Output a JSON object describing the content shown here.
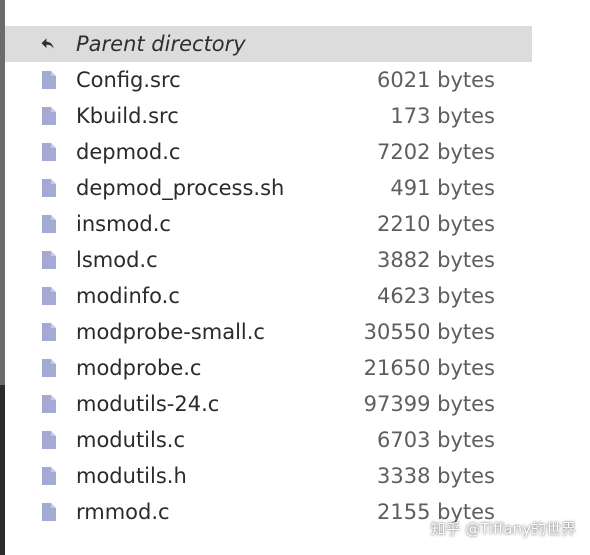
{
  "listing": {
    "parent": {
      "label": "Parent directory",
      "icon": "back-arrow-icon"
    },
    "files": [
      {
        "name": "Config.src",
        "size": "6021 bytes"
      },
      {
        "name": "Kbuild.src",
        "size": "173 bytes"
      },
      {
        "name": "depmod.c",
        "size": "7202 bytes"
      },
      {
        "name": "depmod_process.sh",
        "size": "491 bytes"
      },
      {
        "name": "insmod.c",
        "size": "2210 bytes"
      },
      {
        "name": "lsmod.c",
        "size": "3882 bytes"
      },
      {
        "name": "modinfo.c",
        "size": "4623 bytes"
      },
      {
        "name": "modprobe-small.c",
        "size": "30550 bytes"
      },
      {
        "name": "modprobe.c",
        "size": "21650 bytes"
      },
      {
        "name": "modutils-24.c",
        "size": "97399 bytes"
      },
      {
        "name": "modutils.c",
        "size": "6703 bytes"
      },
      {
        "name": "modutils.h",
        "size": "3338 bytes"
      },
      {
        "name": "rmmod.c",
        "size": "2155 bytes"
      }
    ]
  },
  "watermark": "知乎 @Tiffany的世界",
  "colors": {
    "file_icon": "#a4aad4",
    "parent_row_bg": "#dcdcdc",
    "text": "#2b2b2b",
    "size_text": "#5e5e5e"
  }
}
